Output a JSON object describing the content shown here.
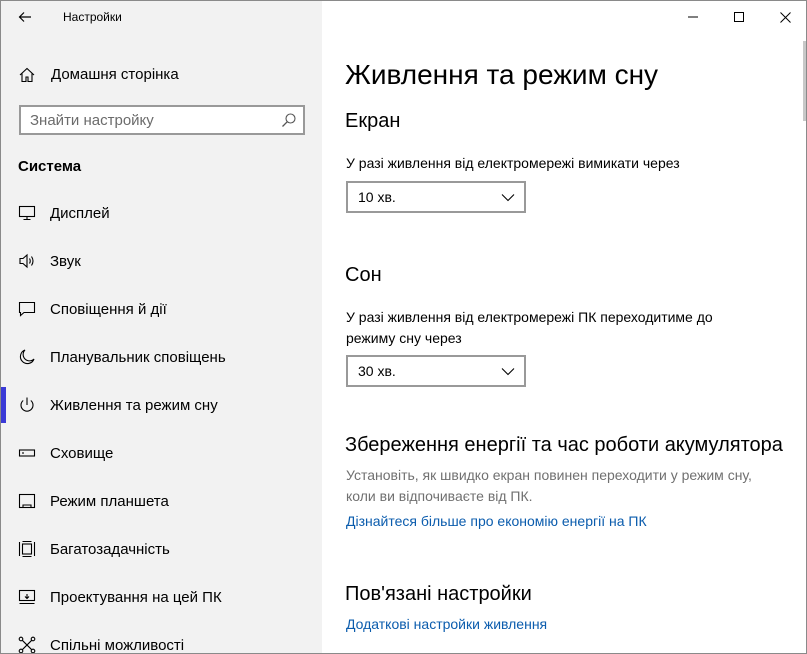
{
  "window": {
    "app_title": "Настройки"
  },
  "sidebar": {
    "home_label": "Домашня сторінка",
    "search_placeholder": "Знайти настройку",
    "section_label": "Система",
    "items": [
      {
        "label": "Дисплей",
        "icon": "monitor-icon"
      },
      {
        "label": "Звук",
        "icon": "speaker-icon"
      },
      {
        "label": "Сповіщення й дії",
        "icon": "notification-icon"
      },
      {
        "label": "Планувальник сповіщень",
        "icon": "moon-icon"
      },
      {
        "label": "Живлення та режим сну",
        "icon": "power-icon",
        "selected": true
      },
      {
        "label": "Сховище",
        "icon": "storage-icon"
      },
      {
        "label": "Режим планшета",
        "icon": "tablet-icon"
      },
      {
        "label": "Багатозадачність",
        "icon": "multitasking-icon"
      },
      {
        "label": "Проектування на цей ПК",
        "icon": "projecting-icon"
      },
      {
        "label": "Спільні можливості",
        "icon": "shared-experiences-icon"
      }
    ]
  },
  "main": {
    "title": "Живлення та режим сну",
    "screen": {
      "heading": "Екран",
      "description": "У разі живлення від електромережі вимикати через",
      "value": "10 хв."
    },
    "sleep": {
      "heading": "Сон",
      "description_line1": "У разі живлення від електромережі ПК переходитиме до",
      "description_line2": "режиму сну через",
      "value": "30 хв."
    },
    "battery": {
      "heading": "Збереження енергії та час роботи акумулятора",
      "description_line1": "Установіть, як швидко екран повинен переходити у режим сну,",
      "description_line2": "коли ви відпочиваєте від ПК.",
      "link": "Дізнайтеся більше про економію енергії на ПК"
    },
    "related": {
      "heading": "Пов'язані настройки",
      "link": "Додаткові настройки живлення"
    }
  },
  "colors": {
    "sidebar_bg": "#f2f2f2",
    "accent": "#3a3ad6",
    "link": "#0b5cad"
  }
}
